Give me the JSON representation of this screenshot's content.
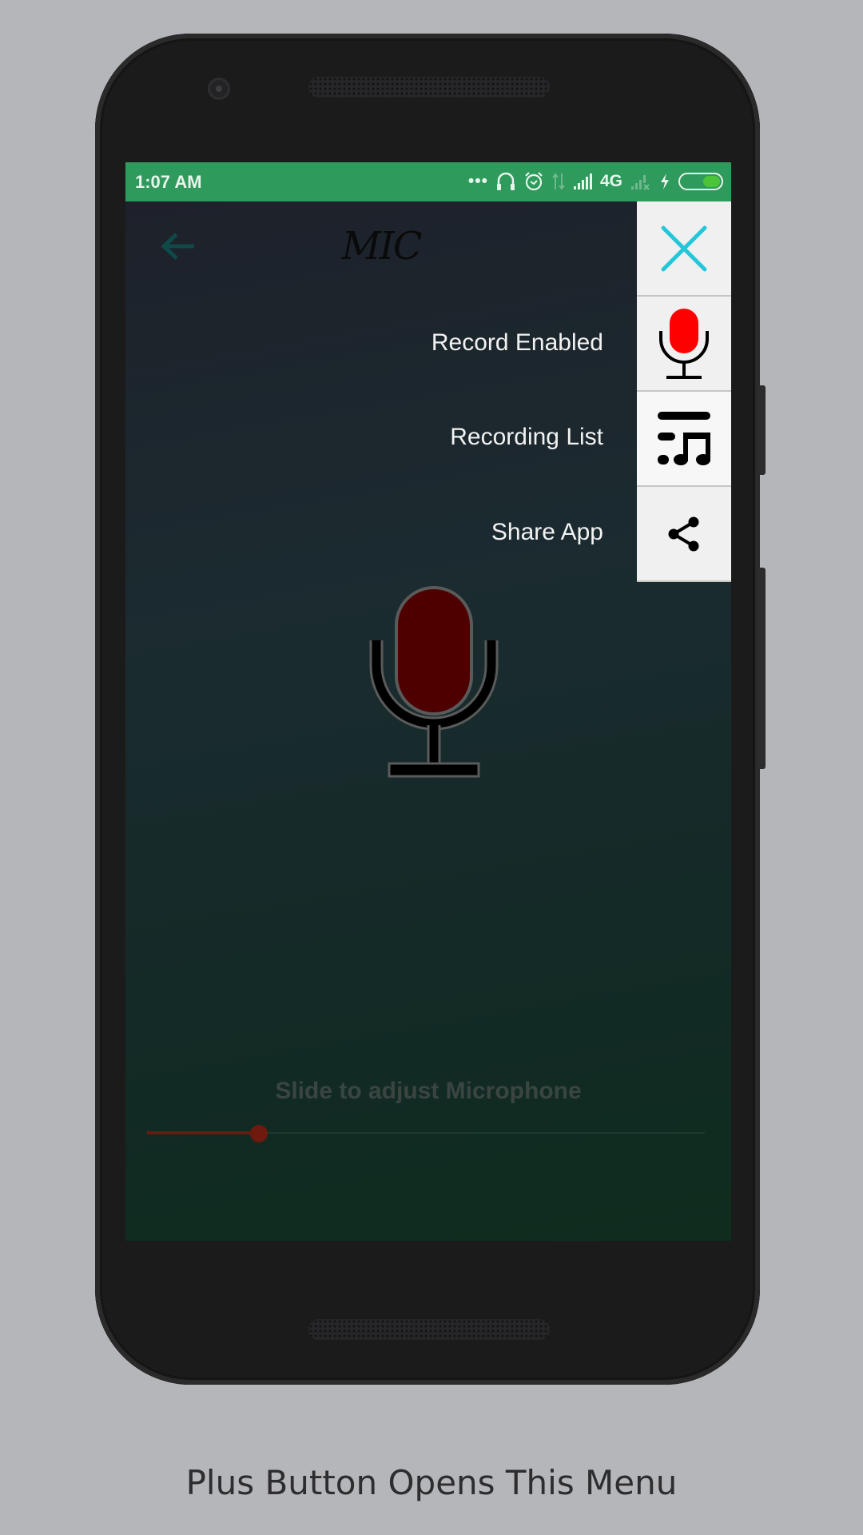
{
  "status_bar": {
    "time": "1:07 AM",
    "icons": [
      "more-dots-icon",
      "headset-icon",
      "alarm-icon",
      "data-transfer-icon",
      "signal-icon",
      "network-type",
      "no-signal-icon",
      "charging-icon",
      "battery-icon"
    ],
    "network_type": "4G",
    "battery_level": 0.45,
    "color": "#2e9a5b"
  },
  "app_bar": {
    "back_icon": "back-arrow-icon",
    "title": "MIC"
  },
  "floating_menu": {
    "close_icon": "close-icon",
    "close_color": "#26c6da",
    "items": [
      {
        "label": "Record Enabled",
        "icon": "microphone-icon"
      },
      {
        "label": "Recording List",
        "icon": "music-list-icon"
      },
      {
        "label": "Share App",
        "icon": "share-icon"
      }
    ]
  },
  "main": {
    "mic_icon": "microphone-icon",
    "slider_label": "Slide to adjust Microphone",
    "slider_value": 0.2
  },
  "caption": "Plus Button Opens This Menu"
}
